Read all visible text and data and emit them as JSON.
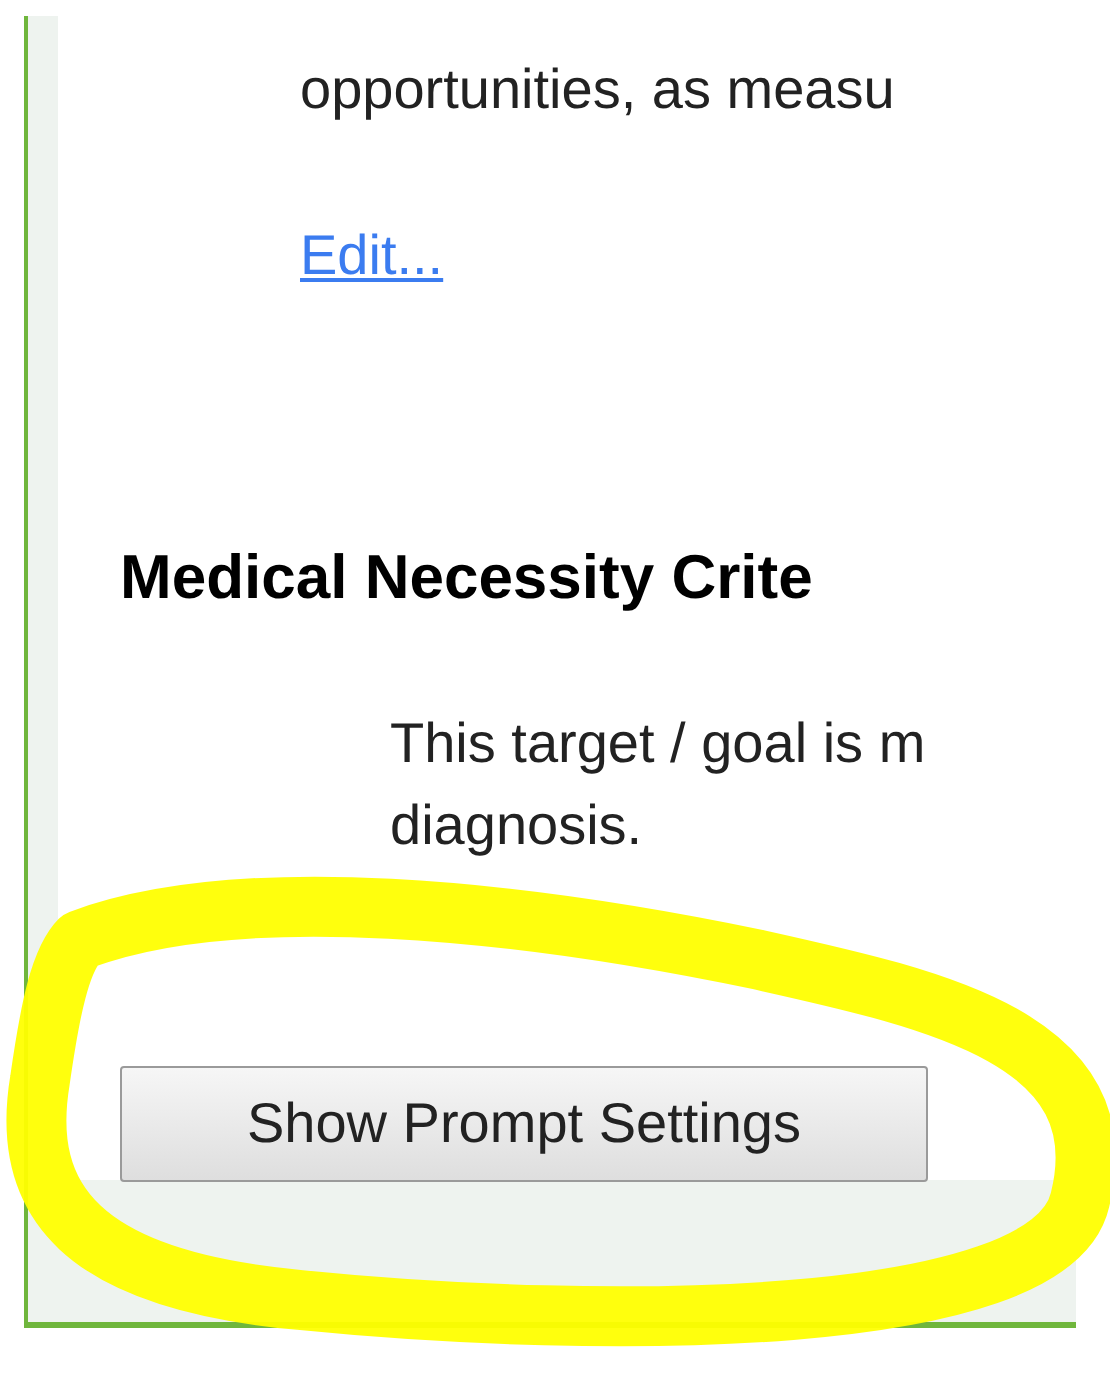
{
  "intro_text": "opportunities, as measu",
  "edit_link": "Edit...",
  "section": {
    "heading": "Medical Necessity Crite",
    "lines": [
      "This target / goal is m",
      "diagnosis."
    ]
  },
  "button": "Show Prompt Settings",
  "annotations": [
    {
      "kind": "ellipse"
    }
  ]
}
